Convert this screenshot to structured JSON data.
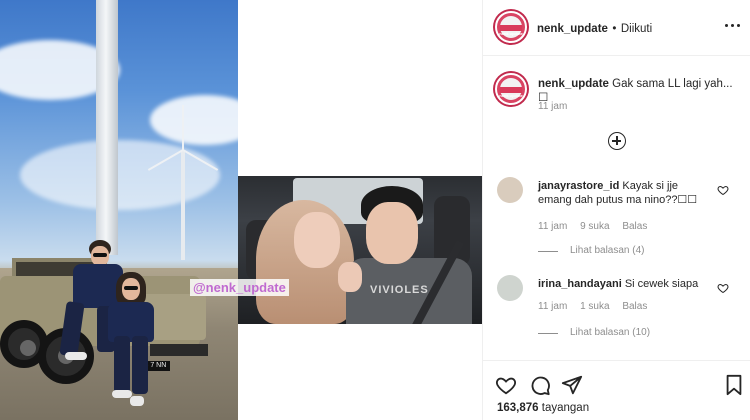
{
  "post": {
    "author": "nenk_update",
    "follow_state": "Diikuti",
    "separator": "•",
    "avatar_text": "nenk update",
    "caption_text": "Gak sama LL lagi yah... ☐",
    "caption_time": "11 jam",
    "watermark": "@nenk_update",
    "plate_text": "B 7 NN",
    "shirt_text": "VIVIOLES"
  },
  "comments": [
    {
      "username": "janayrastore_id",
      "text": "Kayak si jje emang dah putus ma nino??☐☐",
      "time": "11 jam",
      "likes": "9 suka",
      "reply": "Balas",
      "view_replies": "Lihat balasan (4)"
    },
    {
      "username": "irina_handayani",
      "text": "Si cewek siapa",
      "time": "11 jam",
      "likes": "1 suka",
      "reply": "Balas",
      "view_replies": "Lihat balasan (10)"
    }
  ],
  "actions": {
    "icons": [
      "heart-icon",
      "comment-icon",
      "share-icon",
      "bookmark-icon"
    ],
    "views_count": "163,876",
    "views_label": "tayangan"
  },
  "colors": {
    "text": "#262626",
    "muted": "#8e8e8e",
    "border": "#efefef",
    "watermark": "#c06ad0",
    "avatar_ring": "#c12a4d"
  }
}
